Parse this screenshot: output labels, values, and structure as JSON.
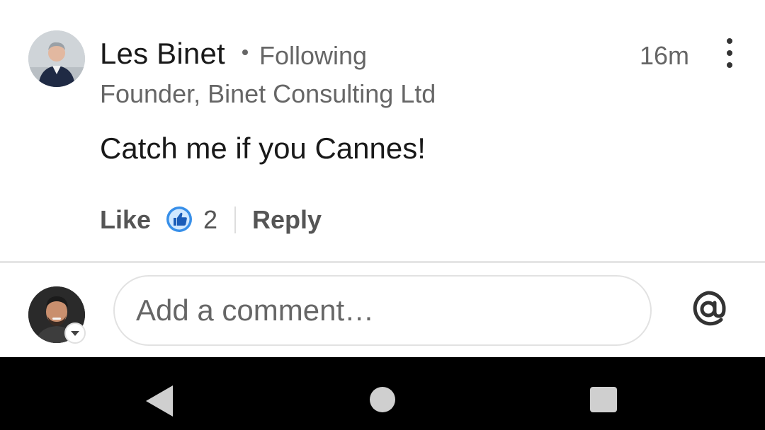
{
  "comment": {
    "author_name": "Les Binet",
    "follow_status": "Following",
    "timestamp": "16m",
    "headline": "Founder, Binet Consulting Ltd",
    "text": "Catch me if you Cannes!",
    "actions": {
      "like_label": "Like",
      "reaction_count": "2",
      "reply_label": "Reply"
    }
  },
  "composer": {
    "placeholder": "Add a comment…",
    "mention_icon": "at-sign-icon"
  },
  "system_nav": {
    "back_icon": "back-triangle-icon",
    "home_icon": "home-circle-icon",
    "recents_icon": "recents-square-icon"
  },
  "colors": {
    "reaction_blue": "#378fe9",
    "text_primary": "#191919",
    "text_secondary": "#666666"
  }
}
